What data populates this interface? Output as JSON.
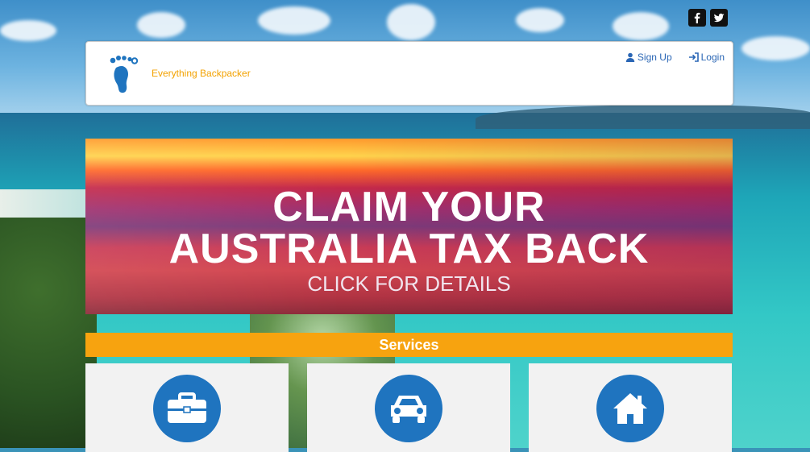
{
  "brand": {
    "name": "Everything Backpacker"
  },
  "header": {
    "links": [
      {
        "label": "Sign Up"
      },
      {
        "label": "Login"
      }
    ]
  },
  "social": {
    "icons": [
      "facebook-icon",
      "twitter-icon"
    ]
  },
  "banner": {
    "line1": "CLAIM YOUR",
    "line2": "AUSTRALIA TAX BACK",
    "line3": "CLICK FOR DETAILS"
  },
  "services": {
    "title": "Services",
    "cards": [
      {
        "icon": "briefcase-icon"
      },
      {
        "icon": "car-icon"
      },
      {
        "icon": "house-icon"
      }
    ]
  },
  "colors": {
    "accent": "#f7a30f",
    "brand_text": "#f3a200",
    "link": "#2a66b5",
    "icon_circle": "#1f74bf"
  }
}
